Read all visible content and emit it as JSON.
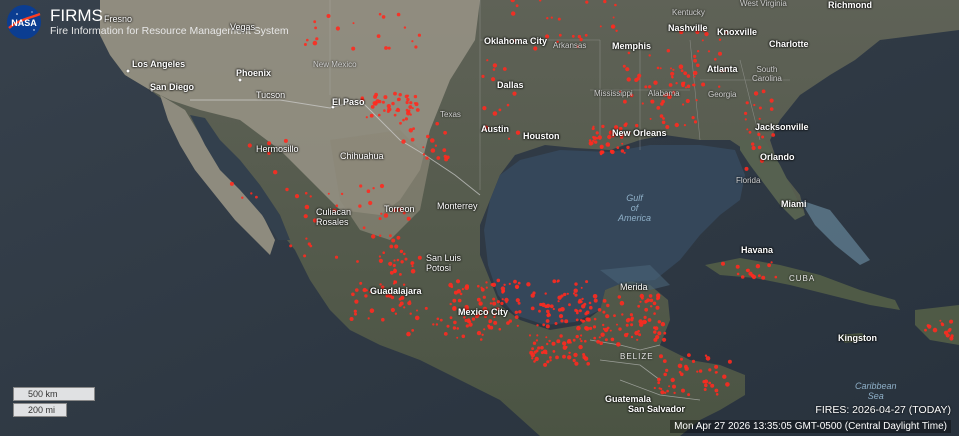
{
  "header": {
    "app_title": "FIRMS",
    "app_subtitle": "Fire Information for Resource Management System",
    "logo_icon": "nasa-logo-icon",
    "logo_text": "NASA"
  },
  "cities": {
    "fresno": "Fresno",
    "los_angeles": "Los Angeles",
    "san_diego": "San Diego",
    "phoenix": "Phoenix",
    "tucson": "Tucson",
    "vegas": "Vegas",
    "el_paso": "El Paso",
    "hermosillo": "Hermosillo",
    "chihuahua": "Chihuahua",
    "culiacan": "Culiacan\nRosales",
    "torreon": "Torreon",
    "monterrey": "Monterrey",
    "san_luis": "San Luis\nPotosi",
    "guadalajara": "Guadalajara",
    "mexico_city": "Mexico City",
    "oklahoma_city": "Oklahoma City",
    "dallas": "Dallas",
    "austin": "Austin",
    "houston": "Houston",
    "memphis": "Memphis",
    "nashville": "Nashville",
    "knoxville": "Knoxville",
    "atlanta": "Atlanta",
    "charlotte": "Charlotte",
    "richmond": "Richmond",
    "new_orleans": "New Orleans",
    "jacksonville": "Jacksonville",
    "orlando": "Orlando",
    "miami": "Miami",
    "havana": "Havana",
    "merida": "Merida",
    "kingston": "Kingston",
    "guatemala": "Guatemala",
    "san_salvador": "San Salvador"
  },
  "regions": {
    "kentucky": "Kentucky",
    "west_virginia": "West Virginia",
    "arkansas": "Arkansas",
    "new_mexico": "New Mexico",
    "texas": "Texas",
    "mississippi": "Mississippi",
    "alabama": "Alabama",
    "georgia": "Georgia",
    "south_carolina": "South\nCarolina",
    "florida": "Florida",
    "cuba": "CUBA",
    "belize": "BELIZE"
  },
  "water": {
    "gulf": "Gulf\nof\nAmerica",
    "caribbean": "Caribbean\nSea"
  },
  "scale": {
    "km": "500 km",
    "mi": "200 mi"
  },
  "fires_label": "FIRES: 2026-04-27 (TODAY)",
  "date_label": "Mon Apr 27 2026 13:35:05 GMT-0500 (Central Daylight Time)",
  "colors": {
    "ocean": "#2e3a47",
    "land": "#6b6e66",
    "desert": "#a8a294",
    "fire": "#ff2a1f"
  }
}
